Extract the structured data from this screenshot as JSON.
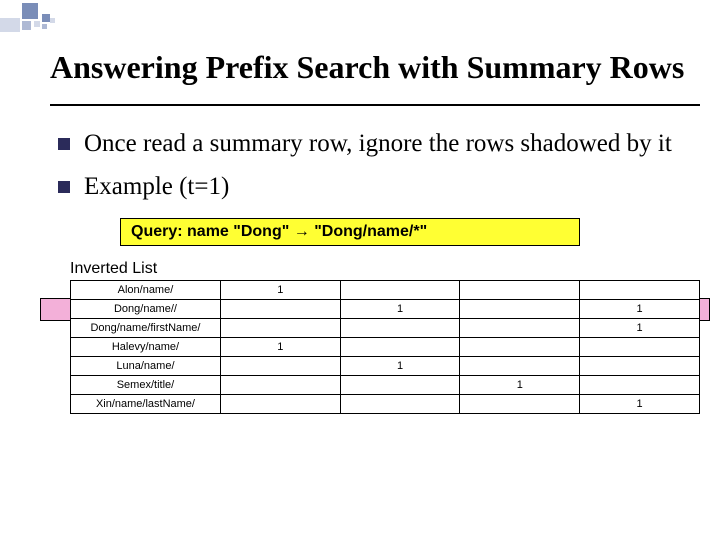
{
  "title": "Answering Prefix Search with Summary Rows",
  "bullets": [
    "Once read a summary row, ignore the rows shadowed by it",
    "Example (t=1)"
  ],
  "query_label_prefix": "Query: name \"Dong\" ",
  "query_arrow": "→",
  "query_suffix": " \"Dong/name/*\"",
  "inverted_label": "Inverted List",
  "chart_data": {
    "type": "table",
    "title": "Inverted List",
    "columns": [
      "key",
      "c1",
      "c2",
      "c3",
      "c4"
    ],
    "highlighted_row_index": 1,
    "rows": [
      {
        "key": "Alon/name/",
        "c1": "1",
        "c2": "",
        "c3": "",
        "c4": ""
      },
      {
        "key": "Dong/name//",
        "c1": "",
        "c2": "1",
        "c3": "",
        "c4": "1"
      },
      {
        "key": "Dong/name/firstName/",
        "c1": "",
        "c2": "",
        "c3": "",
        "c4": "1"
      },
      {
        "key": "Halevy/name/",
        "c1": "1",
        "c2": "",
        "c3": "",
        "c4": ""
      },
      {
        "key": "Luna/name/",
        "c1": "",
        "c2": "1",
        "c3": "",
        "c4": ""
      },
      {
        "key": "Semex/title/",
        "c1": "",
        "c2": "",
        "c3": "1",
        "c4": ""
      },
      {
        "key": "Xin/name/lastName/",
        "c1": "",
        "c2": "",
        "c3": "",
        "c4": "1"
      }
    ]
  }
}
